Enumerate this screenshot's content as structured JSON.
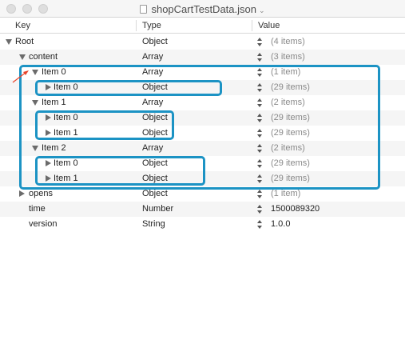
{
  "window": {
    "title": "shopCartTestData.json"
  },
  "columns": {
    "key": "Key",
    "type": "Type",
    "value": "Value"
  },
  "rows": [
    {
      "key": "Root",
      "type": "Object",
      "value": "(4 items)",
      "count": true
    },
    {
      "key": "content",
      "type": "Array",
      "value": "(3 items)",
      "count": true
    },
    {
      "key": "Item 0",
      "type": "Array",
      "value": "(1 item)",
      "count": true
    },
    {
      "key": "Item 0",
      "type": "Object",
      "value": "(29 items)",
      "count": true
    },
    {
      "key": "Item 1",
      "type": "Array",
      "value": "(2 items)",
      "count": true
    },
    {
      "key": "Item 0",
      "type": "Object",
      "value": "(29 items)",
      "count": true
    },
    {
      "key": "Item 1",
      "type": "Object",
      "value": "(29 items)",
      "count": true
    },
    {
      "key": "Item 2",
      "type": "Array",
      "value": "(2 items)",
      "count": true
    },
    {
      "key": "Item 0",
      "type": "Object",
      "value": "(29 items)",
      "count": true
    },
    {
      "key": "Item 1",
      "type": "Object",
      "value": "(29 items)",
      "count": true
    },
    {
      "key": "opens",
      "type": "Object",
      "value": "(1 item)",
      "count": true
    },
    {
      "key": "time",
      "type": "Number",
      "value": "1500089320",
      "count": false
    },
    {
      "key": "version",
      "type": "String",
      "value": "1.0.0",
      "count": false
    }
  ],
  "colors": {
    "highlight": "#1c93c4",
    "arrow": "#e8442a"
  }
}
